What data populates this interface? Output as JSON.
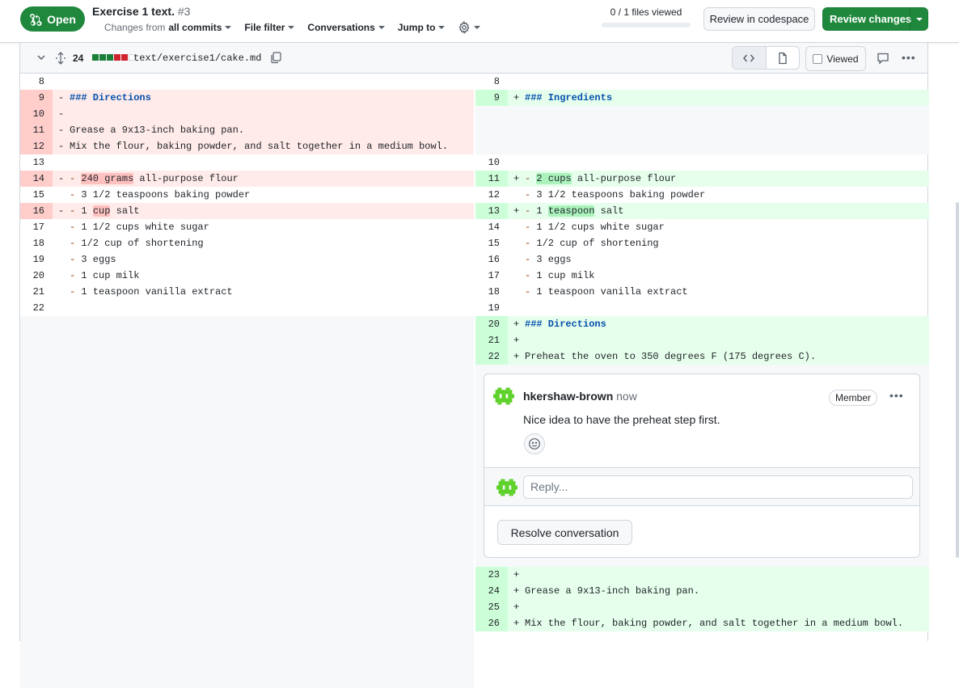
{
  "header": {
    "state": "Open",
    "title": "Exercise 1 text.",
    "number": "#3",
    "changes_prefix": "Changes from",
    "changes_value": "all commits",
    "file_filter": "File filter",
    "conversations": "Conversations",
    "jump_to": "Jump to",
    "files_viewed": "0 / 1 files viewed",
    "review_codespace": "Review in codespace",
    "review_changes": "Review changes"
  },
  "file": {
    "changed_lines": "24",
    "path": "text/exercise1/cake.md",
    "viewed_label": "Viewed",
    "diffstat": [
      "#1a7f37",
      "#1a7f37",
      "#1a7f37",
      "#cf222e",
      "#cf222e",
      "#ffffff"
    ]
  },
  "diff": {
    "left": [
      {
        "n": "8",
        "t": "ctx",
        "m": "",
        "segs": [
          {
            "x": ""
          }
        ]
      },
      {
        "n": "9",
        "t": "del",
        "m": "-",
        "segs": [
          {
            "x": "### Directions",
            "c": "hdr"
          }
        ]
      },
      {
        "n": "10",
        "t": "del",
        "m": "-",
        "segs": [
          {
            "x": ""
          }
        ]
      },
      {
        "n": "11",
        "t": "del",
        "m": "-",
        "segs": [
          {
            "x": "Grease a 9x13-inch baking pan."
          }
        ]
      },
      {
        "n": "12",
        "t": "del",
        "m": "-",
        "segs": [
          {
            "x": "Mix the flour, baking powder, and salt together in a medium bowl."
          }
        ]
      },
      {
        "n": "13",
        "t": "ctx",
        "m": "",
        "segs": [
          {
            "x": ""
          }
        ]
      },
      {
        "n": "14",
        "t": "del",
        "m": "-",
        "segs": [
          {
            "x": "- ",
            "c": "bullet"
          },
          {
            "x": "240 grams",
            "c": "hl-del"
          },
          {
            "x": " all-purpose flour"
          }
        ]
      },
      {
        "n": "15",
        "t": "ctx",
        "m": "",
        "segs": [
          {
            "x": "- ",
            "c": "bullet"
          },
          {
            "x": "3 1/2 teaspoons baking powder"
          }
        ]
      },
      {
        "n": "16",
        "t": "del",
        "m": "-",
        "segs": [
          {
            "x": "- ",
            "c": "bullet"
          },
          {
            "x": "1 "
          },
          {
            "x": "cup",
            "c": "hl-del"
          },
          {
            "x": " salt"
          }
        ]
      },
      {
        "n": "17",
        "t": "ctx",
        "m": "",
        "segs": [
          {
            "x": "- ",
            "c": "bullet"
          },
          {
            "x": "1 1/2 cups white sugar"
          }
        ]
      },
      {
        "n": "18",
        "t": "ctx",
        "m": "",
        "segs": [
          {
            "x": "- ",
            "c": "bullet"
          },
          {
            "x": "1/2 cup of shortening"
          }
        ]
      },
      {
        "n": "19",
        "t": "ctx",
        "m": "",
        "segs": [
          {
            "x": "- ",
            "c": "bullet"
          },
          {
            "x": "3 eggs"
          }
        ]
      },
      {
        "n": "20",
        "t": "ctx",
        "m": "",
        "segs": [
          {
            "x": "- ",
            "c": "bullet"
          },
          {
            "x": "1 cup milk"
          }
        ]
      },
      {
        "n": "21",
        "t": "ctx",
        "m": "",
        "segs": [
          {
            "x": "- ",
            "c": "bullet"
          },
          {
            "x": "1 teaspoon vanilla extract"
          }
        ]
      },
      {
        "n": "22",
        "t": "ctx",
        "m": "",
        "segs": [
          {
            "x": ""
          }
        ]
      }
    ],
    "right": [
      {
        "n": "8",
        "t": "ctx",
        "m": "",
        "segs": [
          {
            "x": ""
          }
        ]
      },
      {
        "n": "9",
        "t": "add",
        "m": "+",
        "segs": [
          {
            "x": "### Ingredients",
            "c": "hdr"
          }
        ]
      },
      {
        "n": "",
        "t": "empty",
        "m": "",
        "segs": [
          {
            "x": ""
          }
        ]
      },
      {
        "n": "",
        "t": "empty",
        "m": "",
        "segs": [
          {
            "x": ""
          }
        ]
      },
      {
        "n": "",
        "t": "empty",
        "m": "",
        "segs": [
          {
            "x": ""
          }
        ]
      },
      {
        "n": "10",
        "t": "ctx",
        "m": "",
        "segs": [
          {
            "x": ""
          }
        ]
      },
      {
        "n": "11",
        "t": "add",
        "m": "+",
        "segs": [
          {
            "x": "- ",
            "c": "bullet"
          },
          {
            "x": "2 cups",
            "c": "hl-add"
          },
          {
            "x": " all-purpose flour"
          }
        ]
      },
      {
        "n": "12",
        "t": "ctx",
        "m": "",
        "segs": [
          {
            "x": "- ",
            "c": "bullet"
          },
          {
            "x": "3 1/2 teaspoons baking powder"
          }
        ]
      },
      {
        "n": "13",
        "t": "add",
        "m": "+",
        "segs": [
          {
            "x": "- ",
            "c": "bullet"
          },
          {
            "x": "1 "
          },
          {
            "x": "teaspoon",
            "c": "hl-add"
          },
          {
            "x": " salt"
          }
        ]
      },
      {
        "n": "14",
        "t": "ctx",
        "m": "",
        "segs": [
          {
            "x": "- ",
            "c": "bullet"
          },
          {
            "x": "1 1/2 cups white sugar"
          }
        ]
      },
      {
        "n": "15",
        "t": "ctx",
        "m": "",
        "segs": [
          {
            "x": "- ",
            "c": "bullet"
          },
          {
            "x": "1/2 cup of shortening"
          }
        ]
      },
      {
        "n": "16",
        "t": "ctx",
        "m": "",
        "segs": [
          {
            "x": "- ",
            "c": "bullet"
          },
          {
            "x": "3 eggs"
          }
        ]
      },
      {
        "n": "17",
        "t": "ctx",
        "m": "",
        "segs": [
          {
            "x": "- ",
            "c": "bullet"
          },
          {
            "x": "1 cup milk"
          }
        ]
      },
      {
        "n": "18",
        "t": "ctx",
        "m": "",
        "segs": [
          {
            "x": "- ",
            "c": "bullet"
          },
          {
            "x": "1 teaspoon vanilla extract"
          }
        ]
      },
      {
        "n": "19",
        "t": "ctx",
        "m": "",
        "segs": [
          {
            "x": ""
          }
        ]
      },
      {
        "n": "20",
        "t": "add",
        "m": "+",
        "segs": [
          {
            "x": "### Directions",
            "c": "hdr"
          }
        ]
      },
      {
        "n": "21",
        "t": "add",
        "m": "+",
        "segs": [
          {
            "x": ""
          }
        ]
      },
      {
        "n": "22",
        "t": "add",
        "m": "+",
        "segs": [
          {
            "x": "Preheat the oven to 350 degrees F (175 degrees C)."
          }
        ]
      }
    ],
    "right_after": [
      {
        "n": "23",
        "t": "add",
        "m": "+",
        "segs": [
          {
            "x": ""
          }
        ]
      },
      {
        "n": "24",
        "t": "add",
        "m": "+",
        "segs": [
          {
            "x": "Grease a 9x13-inch baking pan."
          }
        ]
      },
      {
        "n": "25",
        "t": "add",
        "m": "+",
        "segs": [
          {
            "x": ""
          }
        ]
      },
      {
        "n": "26",
        "t": "add",
        "m": "+",
        "segs": [
          {
            "x": "Mix the flour, baking powder, and salt together in a medium bowl."
          }
        ]
      }
    ]
  },
  "thread": {
    "author": "hkershaw-brown",
    "time": "now",
    "role": "Member",
    "body": "Nice idea to have the preheat step first.",
    "reply_placeholder": "Reply...",
    "resolve": "Resolve conversation"
  }
}
